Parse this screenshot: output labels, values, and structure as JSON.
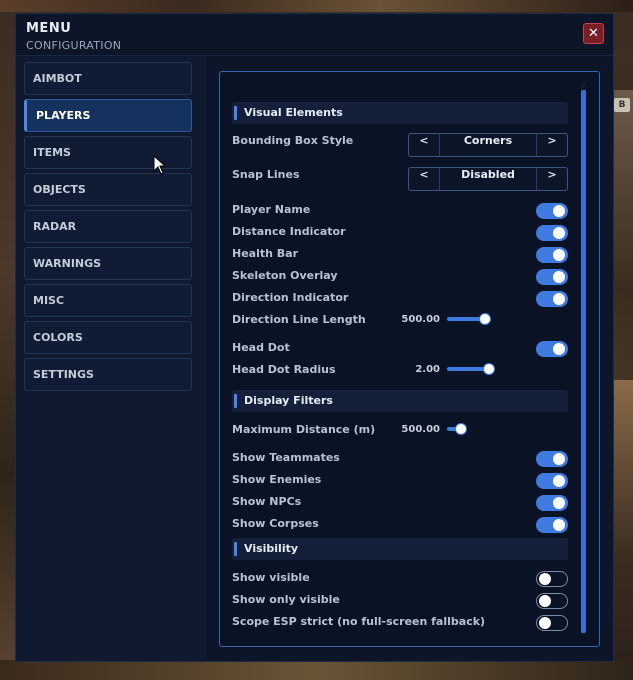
{
  "header": {
    "title": "MENU",
    "subtitle": "CONFIGURATION",
    "close_label": "✕"
  },
  "background": {
    "sign_text": "B"
  },
  "sidebar": {
    "items": [
      {
        "label": "AIMBOT"
      },
      {
        "label": "PLAYERS",
        "active": true
      },
      {
        "label": "ITEMS"
      },
      {
        "label": "OBJECTS"
      },
      {
        "label": "RADAR"
      },
      {
        "label": "WARNINGS"
      },
      {
        "label": "MISC"
      },
      {
        "label": "COLORS"
      },
      {
        "label": "SETTINGS"
      }
    ]
  },
  "sections": {
    "visual": {
      "title": "Visual Elements"
    },
    "filters": {
      "title": "Display Filters"
    },
    "visibility": {
      "title": "Visibility"
    }
  },
  "settings": {
    "bounding_box_style": {
      "label": "Bounding Box Style",
      "value": "Corners",
      "prev": "<",
      "next": ">"
    },
    "snap_lines": {
      "label": "Snap Lines",
      "value": "Disabled",
      "prev": "<",
      "next": ">"
    },
    "player_name": {
      "label": "Player Name",
      "on": true
    },
    "distance_indicator": {
      "label": "Distance Indicator",
      "on": true
    },
    "health_bar": {
      "label": "Health Bar",
      "on": true
    },
    "skeleton_overlay": {
      "label": "Skeleton Overlay",
      "on": true
    },
    "direction_indicator": {
      "label": "Direction Indicator",
      "on": true
    },
    "direction_line_length": {
      "label": "Direction Line Length",
      "value": "500.00",
      "fraction": 0.8
    },
    "head_dot": {
      "label": "Head Dot",
      "on": true
    },
    "head_dot_radius": {
      "label": "Head Dot Radius",
      "value": "2.00",
      "fraction": 0.9
    },
    "maximum_distance": {
      "label": "Maximum Distance (m)",
      "value": "500.00",
      "fraction": 0.2
    },
    "show_teammates": {
      "label": "Show Teammates",
      "on": true
    },
    "show_enemies": {
      "label": "Show Enemies",
      "on": true
    },
    "show_npcs": {
      "label": "Show NPCs",
      "on": true
    },
    "show_corpses": {
      "label": "Show Corpses",
      "on": true
    },
    "show_visible": {
      "label": "Show visible",
      "on": false
    },
    "show_only_visible": {
      "label": "Show only visible",
      "on": false
    },
    "scope_esp_strict": {
      "label": "Scope ESP strict (no full-screen fallback)",
      "on": false
    }
  },
  "colors": {
    "accent": "#3f7be0",
    "close": "#7a1e26",
    "panel_border": "#3a66b0"
  },
  "icons": {
    "close": "close-icon",
    "cursor": "mouse-cursor-icon"
  }
}
